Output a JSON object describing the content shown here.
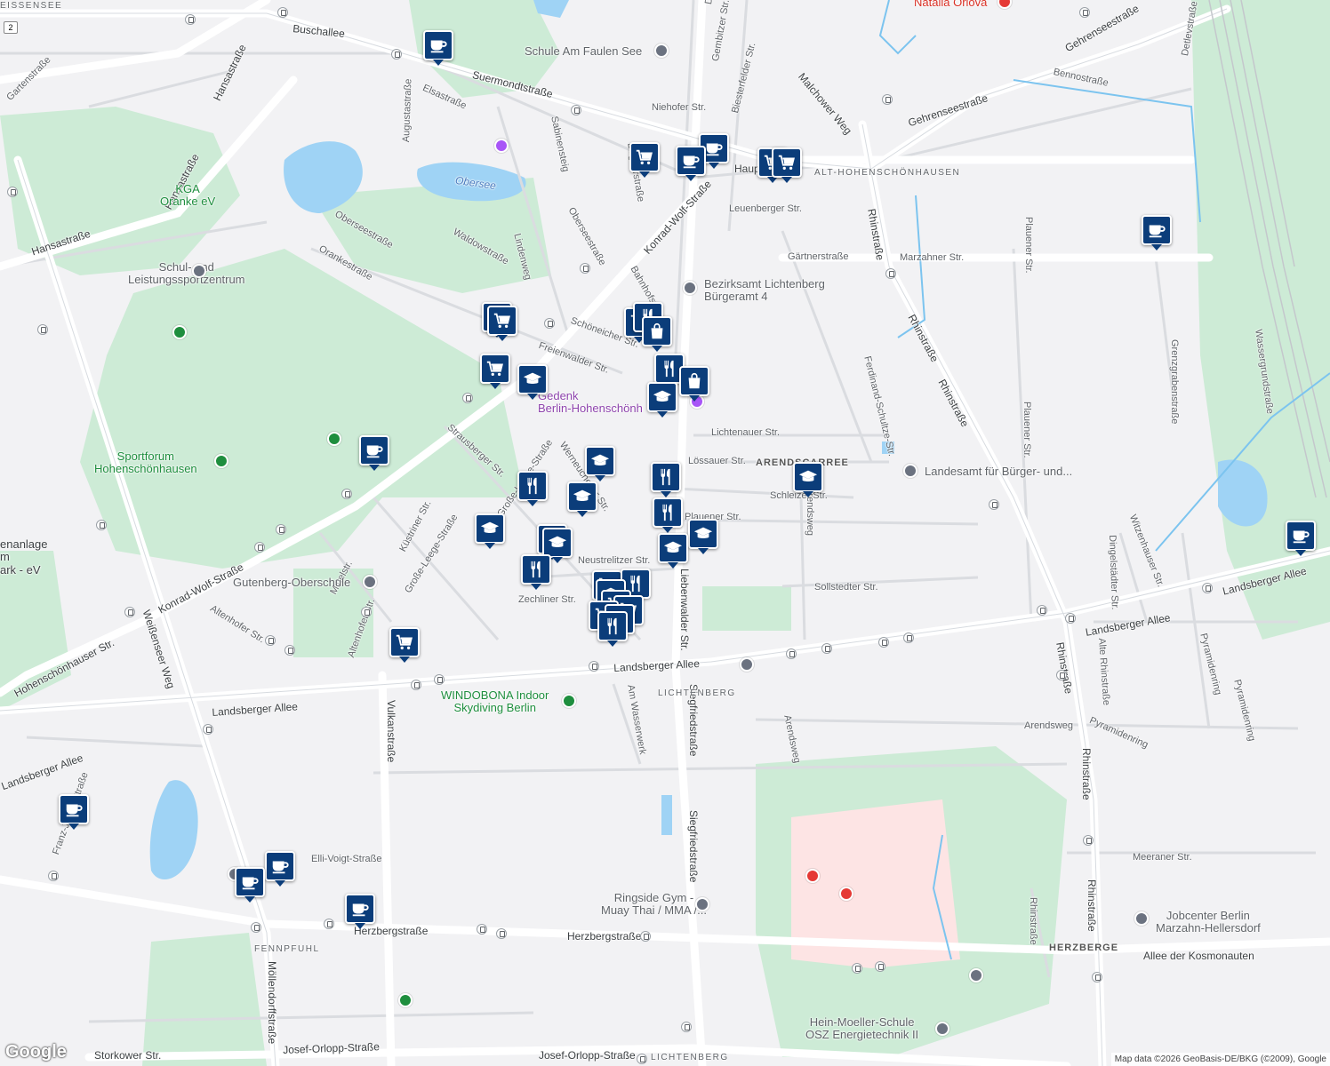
{
  "map": {
    "logo": "Google",
    "attribution": "Map data ©2026 GeoBasis-DE/BKG (©2009), Google",
    "route_shield": "2"
  },
  "streets": [
    "Buschallee",
    "Suermondtstraße",
    "Hansastraße",
    "Elsastraße",
    "Augustastraße",
    "Gartenstraße",
    "Oberseestraße",
    "Orankestraße",
    "Waldowstraße",
    "Lindenweg",
    "Sabinensteig",
    "Konrad-Wolf-Straße",
    "Schöneicher Str.",
    "Freienwalder Str.",
    "Strausberger Str.",
    "Große-Leege-Straße",
    "Werneuchener Str.",
    "Küstriner Str.",
    "Mittelstr.",
    "Altenhofer Str.",
    "Hohenschönhauser Str.",
    "Weißenseer Weg",
    "Landsberger Allee",
    "Vulkanstraße",
    "Am Wasserwerk",
    "Siegfriedstraße",
    "Liebenwalder Str.",
    "Zechliner Str.",
    "Neustrelitzer Str.",
    "Lichtenauer Str.",
    "Lössauer Str.",
    "Schleizer Str.",
    "Plauener Str.",
    "Sollstedter Str.",
    "Arendsweg",
    "Rhinstraße",
    "Ferdinand-Schultze-Str.",
    "Marzahner Str.",
    "Gärtnerstraße",
    "Leuenberger Str.",
    "Bahnhofstr.",
    "Degnerstraße",
    "Gembitzer Str.",
    "Biesterfelder Str.",
    "Niehofer Str.",
    "Malchower Weg",
    "Gehrenseestraße",
    "Bennostraße",
    "Detlevstraße",
    "Grenzgrabenstraße",
    "Wassergrundstraße",
    "Witzenhauser Str.",
    "Dingelstädter Str.",
    "Alte Rhinstraße",
    "Pyramidenring",
    "Meeraner Str.",
    "Allee der Kosmonauten",
    "Herzbergstraße",
    "Elli-Voigt-Straße",
    "Möllendorffstraße",
    "Josef-Orlopp-Straße",
    "Storkower Str.",
    "Franz-Jacob-Straße",
    "Rhinstraße",
    "Haup"
  ],
  "areas": [
    "ALT-HOHENSCHÖNHAUSEN",
    "ARENDSCARREE",
    "LICHTENBERG",
    "FENNPFUHL",
    "HERZBERGE",
    "LICHTENBERG"
  ],
  "water": [
    "Obersee"
  ],
  "places": {
    "schule_faulen_see": "Schule Am Faulen See",
    "kga_oranke": "KGA\nOranke eV",
    "schul_leistung": "Schul- und\nLeistungssportzentrum",
    "sportforum": "Sportforum\nHohenschönhausen",
    "bezirksamt": "Bezirksamt Lichtenberg\nBürgeramt 4",
    "gedenk": "Gedenk\nBerlin-Hohenschönh",
    "landesamt": "Landesamt für Bürger- und...",
    "gutenberg": "Gutenberg-Oberschule",
    "windobona": "WINDOBONA Indoor\nSkydiving Berlin",
    "ringside": "Ringside Gym -\nMuay Thai / MMA /...",
    "jobcenter": "Jobcenter Berlin\nMarzahn-Hellersdorf",
    "hein_moeller": "Hein-Moeller-Schule\nOSZ Energietechnik II",
    "natalia": "Natalia Orlova",
    "enanlage": "enanlage\nm\nark - eV",
    "eissensee": "EISSENSEE"
  },
  "marker_icons": [
    "coffee-icon",
    "cart-icon",
    "school-icon",
    "restaurant-icon",
    "shopping-bag-icon"
  ],
  "colors": {
    "marker": "#0b3d7a",
    "park": "#c9ecd2",
    "water": "#9fd3f5",
    "hospital": "#fde4e4",
    "road": "#ffffff"
  }
}
